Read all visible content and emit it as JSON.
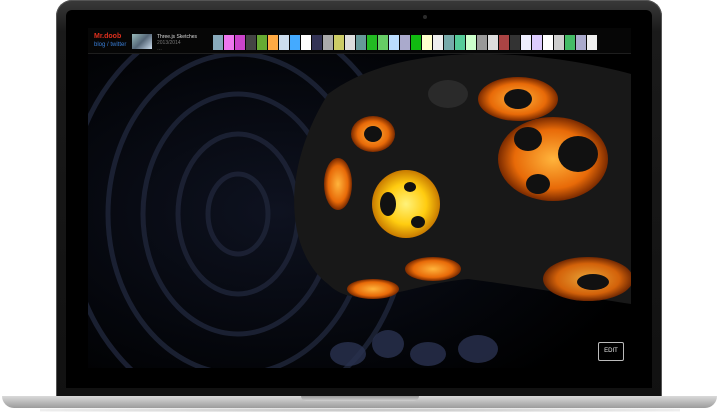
{
  "site": {
    "brand_name": "Mr.doob",
    "brand_links": "blog / twitter"
  },
  "project": {
    "title": "Three.js Sketches",
    "subtitle": "2013/2014",
    "detail": "…"
  },
  "thumbnail_colors": [
    "#8ab",
    "#e7e",
    "#c4c",
    "#444",
    "#6a3",
    "#fa4",
    "#cde",
    "#4af",
    "#fff",
    "#335",
    "#aaa",
    "#cc6",
    "#ddd",
    "#699",
    "#2b2",
    "#6c6",
    "#bdf",
    "#aac",
    "#1b1",
    "#ffc",
    "#eee",
    "#7aa",
    "#5c9",
    "#cfc",
    "#999",
    "#ddd",
    "#a44",
    "#333",
    "#eef",
    "#dcf",
    "#fff",
    "#ccc",
    "#4b6",
    "#aac",
    "#eee"
  ],
  "buttons": {
    "edit": "EDIT"
  },
  "colors": {
    "brand_red": "#e0301e",
    "link_blue": "#3a7fd8",
    "sculpture_orange": "#ff8a1a",
    "sculpture_yellow": "#ffd21a"
  }
}
